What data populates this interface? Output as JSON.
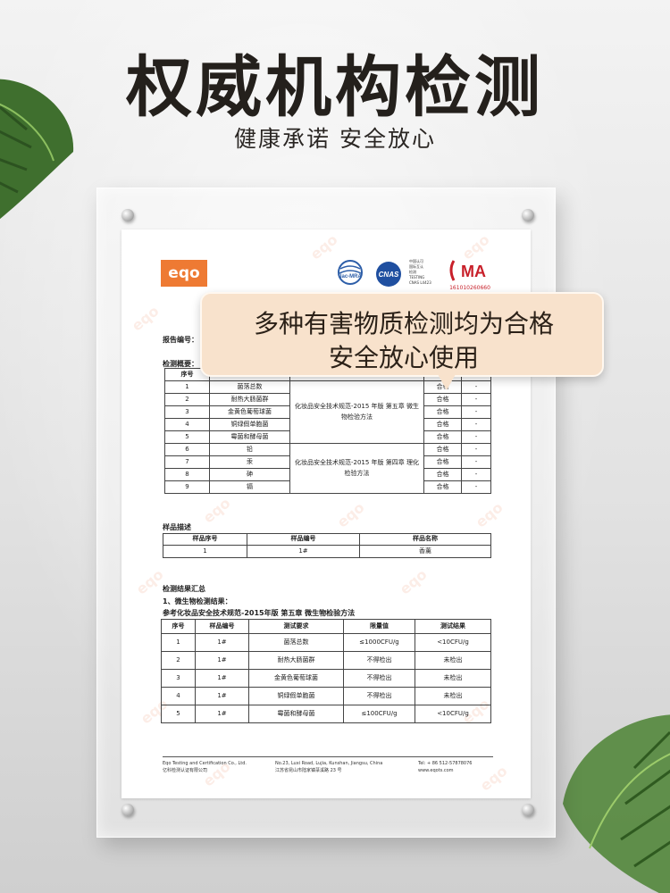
{
  "headline": "权威机构检测",
  "subline": "健康承诺 安全放心",
  "callout": {
    "line1": "多种有害物质检测均为合格",
    "line2": "安全放心使用"
  },
  "report": {
    "logo": "eqo",
    "watermark": "eqo",
    "certs": {
      "ilac": "ilac-MRA",
      "cnas": "CNAS",
      "cnas_note": [
        "中国认可",
        "国际互认",
        "检测",
        "TESTING",
        "CNAS L4423"
      ],
      "cma": "MA",
      "cma_number": "161010260660"
    },
    "report_no_label": "报告编号：",
    "summary_label": "检测概要：",
    "summary_header_no": "序号",
    "summary_rows": [
      {
        "no": "1",
        "item": "菌落总数",
        "result": "合格",
        "note": "-"
      },
      {
        "no": "2",
        "item": "耐热大肠菌群",
        "result": "合格",
        "note": "-"
      },
      {
        "no": "3",
        "item": "金黄色葡萄球菌",
        "result": "合格",
        "note": "-"
      },
      {
        "no": "4",
        "item": "铜绿假单胞菌",
        "result": "合格",
        "note": "-"
      },
      {
        "no": "5",
        "item": "霉菌和酵母菌",
        "result": "合格",
        "note": "-"
      },
      {
        "no": "6",
        "item": "铅",
        "result": "合格",
        "note": "-"
      },
      {
        "no": "7",
        "item": "汞",
        "result": "合格",
        "note": "-"
      },
      {
        "no": "8",
        "item": "砷",
        "result": "合格",
        "note": "-"
      },
      {
        "no": "9",
        "item": "镉",
        "result": "合格",
        "note": "-"
      }
    ],
    "method_micro": "化妆品安全技术规范-2015 年版 第五章 微生物检验方法",
    "method_chem": "化妆品安全技术规范-2015 年版 第四章 理化检验方法",
    "sample_label": "样品描述",
    "sample_headers": [
      "样品序号",
      "样品编号",
      "样品名称"
    ],
    "sample_row": [
      "1",
      "1#",
      "香薰"
    ],
    "results_label": "检测结果汇总",
    "micro_label": "1、微生物检测结果：",
    "ref_label": "参考化妆品安全技术规范-2015年版 第五章 微生物检验方法",
    "result_headers": [
      "序号",
      "样品编号",
      "测试要求",
      "限量值",
      "测试结果"
    ],
    "result_rows": [
      [
        "1",
        "1#",
        "菌落总数",
        "≤1000CFU/g",
        "<10CFU/g"
      ],
      [
        "2",
        "1#",
        "耐热大肠菌群",
        "不得检出",
        "未检出"
      ],
      [
        "3",
        "1#",
        "金黄色葡萄球菌",
        "不得检出",
        "未检出"
      ],
      [
        "4",
        "1#",
        "铜绿假单胞菌",
        "不得检出",
        "未检出"
      ],
      [
        "5",
        "1#",
        "霉菌和酵母菌",
        "≤100CFU/g",
        "<10CFU/g"
      ]
    ],
    "footer": {
      "company_en": "Eqo Testing and Certification Co., Ltd.",
      "company_cn": "亿科检测认证有限公司",
      "address_en": "No.23, Luxi Road, Lujia, Kunshan, Jiangsu, China",
      "address_cn": "江苏省昆山市陆家镇菉溪路 23 号",
      "tel": "Tel: + 86 512-57878076",
      "web": "www.eqots.com"
    }
  }
}
